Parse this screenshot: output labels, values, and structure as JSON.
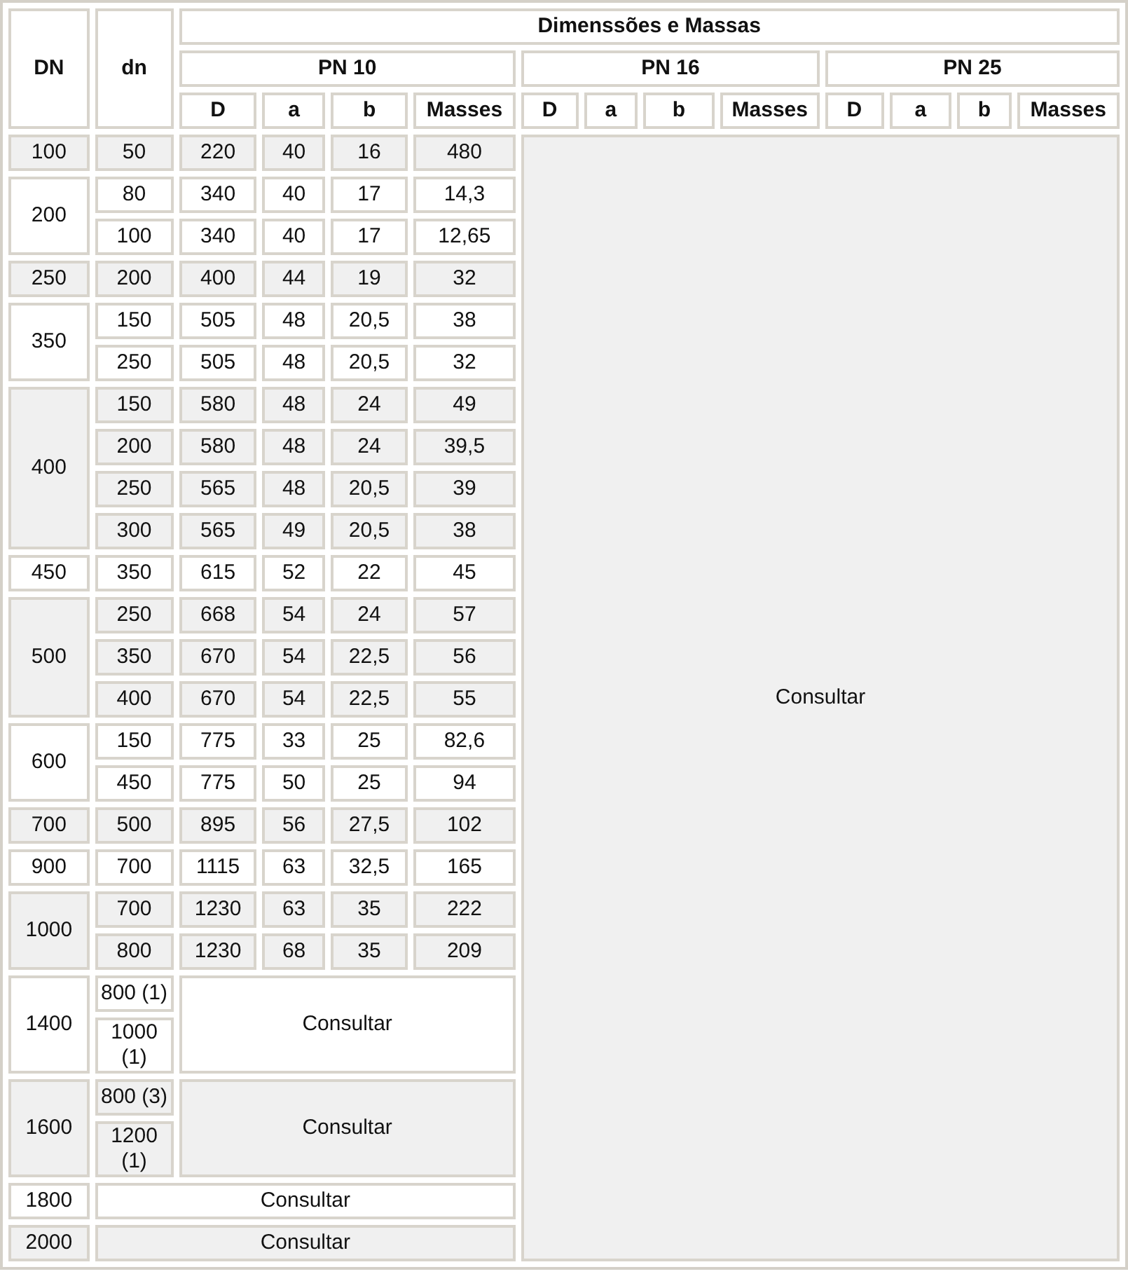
{
  "table": {
    "title": "Dimenssões e Massas",
    "row_headers": [
      "DN",
      "dn"
    ],
    "pressure_classes": [
      {
        "label": "PN 10",
        "columns": [
          "D",
          "a",
          "b",
          "Masses"
        ]
      },
      {
        "label": "PN 16",
        "columns": [
          "D",
          "a",
          "b",
          "Masses"
        ]
      },
      {
        "label": "PN 25",
        "columns": [
          "D",
          "a",
          "b",
          "Masses"
        ]
      }
    ],
    "side_note": "Consultar",
    "groups": [
      {
        "kind": "values",
        "DN": "100",
        "rows": [
          {
            "dn": "50",
            "values": [
              "220",
              "40",
              "16",
              "480"
            ]
          }
        ]
      },
      {
        "kind": "values",
        "DN": "200",
        "rows": [
          {
            "dn": "80",
            "values": [
              "340",
              "40",
              "17",
              "14,3"
            ]
          },
          {
            "dn": "100",
            "values": [
              "340",
              "40",
              "17",
              "12,65"
            ]
          }
        ]
      },
      {
        "kind": "values",
        "DN": "250",
        "rows": [
          {
            "dn": "200",
            "values": [
              "400",
              "44",
              "19",
              "32"
            ]
          }
        ]
      },
      {
        "kind": "values",
        "DN": "350",
        "rows": [
          {
            "dn": "150",
            "values": [
              "505",
              "48",
              "20,5",
              "38"
            ]
          },
          {
            "dn": "250",
            "values": [
              "505",
              "48",
              "20,5",
              "32"
            ]
          }
        ]
      },
      {
        "kind": "values",
        "DN": "400",
        "rows": [
          {
            "dn": "150",
            "values": [
              "580",
              "48",
              "24",
              "49"
            ]
          },
          {
            "dn": "200",
            "values": [
              "580",
              "48",
              "24",
              "39,5"
            ]
          },
          {
            "dn": "250",
            "values": [
              "565",
              "48",
              "20,5",
              "39"
            ]
          },
          {
            "dn": "300",
            "values": [
              "565",
              "49",
              "20,5",
              "38"
            ]
          }
        ]
      },
      {
        "kind": "values",
        "DN": "450",
        "rows": [
          {
            "dn": "350",
            "values": [
              "615",
              "52",
              "22",
              "45"
            ]
          }
        ]
      },
      {
        "kind": "values",
        "DN": "500",
        "rows": [
          {
            "dn": "250",
            "values": [
              "668",
              "54",
              "24",
              "57"
            ]
          },
          {
            "dn": "350",
            "values": [
              "670",
              "54",
              "22,5",
              "56"
            ]
          },
          {
            "dn": "400",
            "values": [
              "670",
              "54",
              "22,5",
              "55"
            ]
          }
        ]
      },
      {
        "kind": "values",
        "DN": "600",
        "rows": [
          {
            "dn": "150",
            "values": [
              "775",
              "33",
              "25",
              "82,6"
            ]
          },
          {
            "dn": "450",
            "values": [
              "775",
              "50",
              "25",
              "94"
            ]
          }
        ]
      },
      {
        "kind": "values",
        "DN": "700",
        "rows": [
          {
            "dn": "500",
            "values": [
              "895",
              "56",
              "27,5",
              "102"
            ]
          }
        ]
      },
      {
        "kind": "values",
        "DN": "900",
        "rows": [
          {
            "dn": "700",
            "values": [
              "1115",
              "63",
              "32,5",
              "165"
            ]
          }
        ]
      },
      {
        "kind": "values",
        "DN": "1000",
        "rows": [
          {
            "dn": "700",
            "values": [
              "1230",
              "63",
              "35",
              "222"
            ]
          },
          {
            "dn": "800",
            "values": [
              "1230",
              "68",
              "35",
              "209"
            ]
          }
        ]
      },
      {
        "kind": "consult_pn10",
        "DN": "1400",
        "note": "Consultar",
        "rows": [
          {
            "dn": "800 (1)"
          },
          {
            "dn": "1000 (1)"
          }
        ]
      },
      {
        "kind": "consult_pn10",
        "DN": "1600",
        "note": "Consultar",
        "rows": [
          {
            "dn": "800 (3)"
          },
          {
            "dn": "1200 (1)"
          }
        ]
      },
      {
        "kind": "consult_all",
        "DN": "1800",
        "note": "Consultar"
      },
      {
        "kind": "consult_all",
        "DN": "2000",
        "note": "Consultar"
      }
    ]
  }
}
